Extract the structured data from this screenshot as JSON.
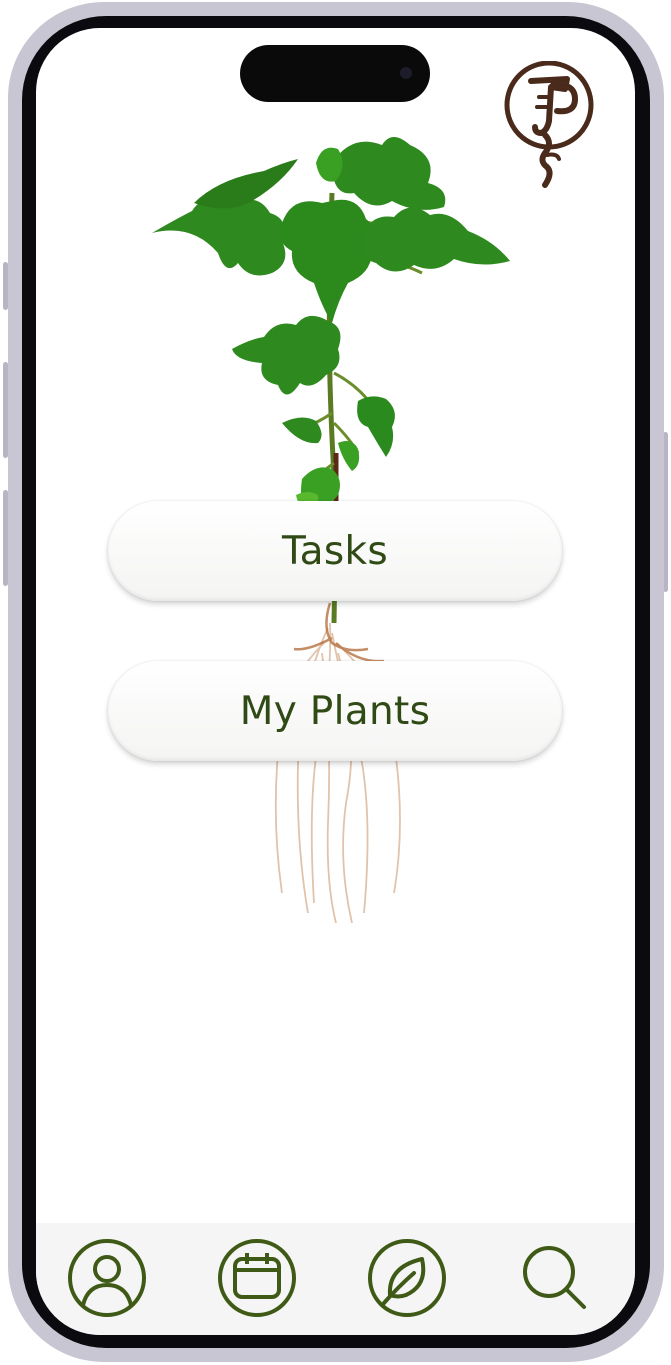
{
  "main": {
    "tasks_label": "Tasks",
    "my_plants_label": "My Plants"
  },
  "icons": {
    "logo": "plant-logo-icon",
    "profile": "profile-icon",
    "calendar": "calendar-icon",
    "leaf": "leaf-icon",
    "search": "search-icon"
  },
  "colors": {
    "accent": "#3f5a16",
    "logo": "#4a2a1b",
    "tabbar_background": "#f5f5f5"
  }
}
